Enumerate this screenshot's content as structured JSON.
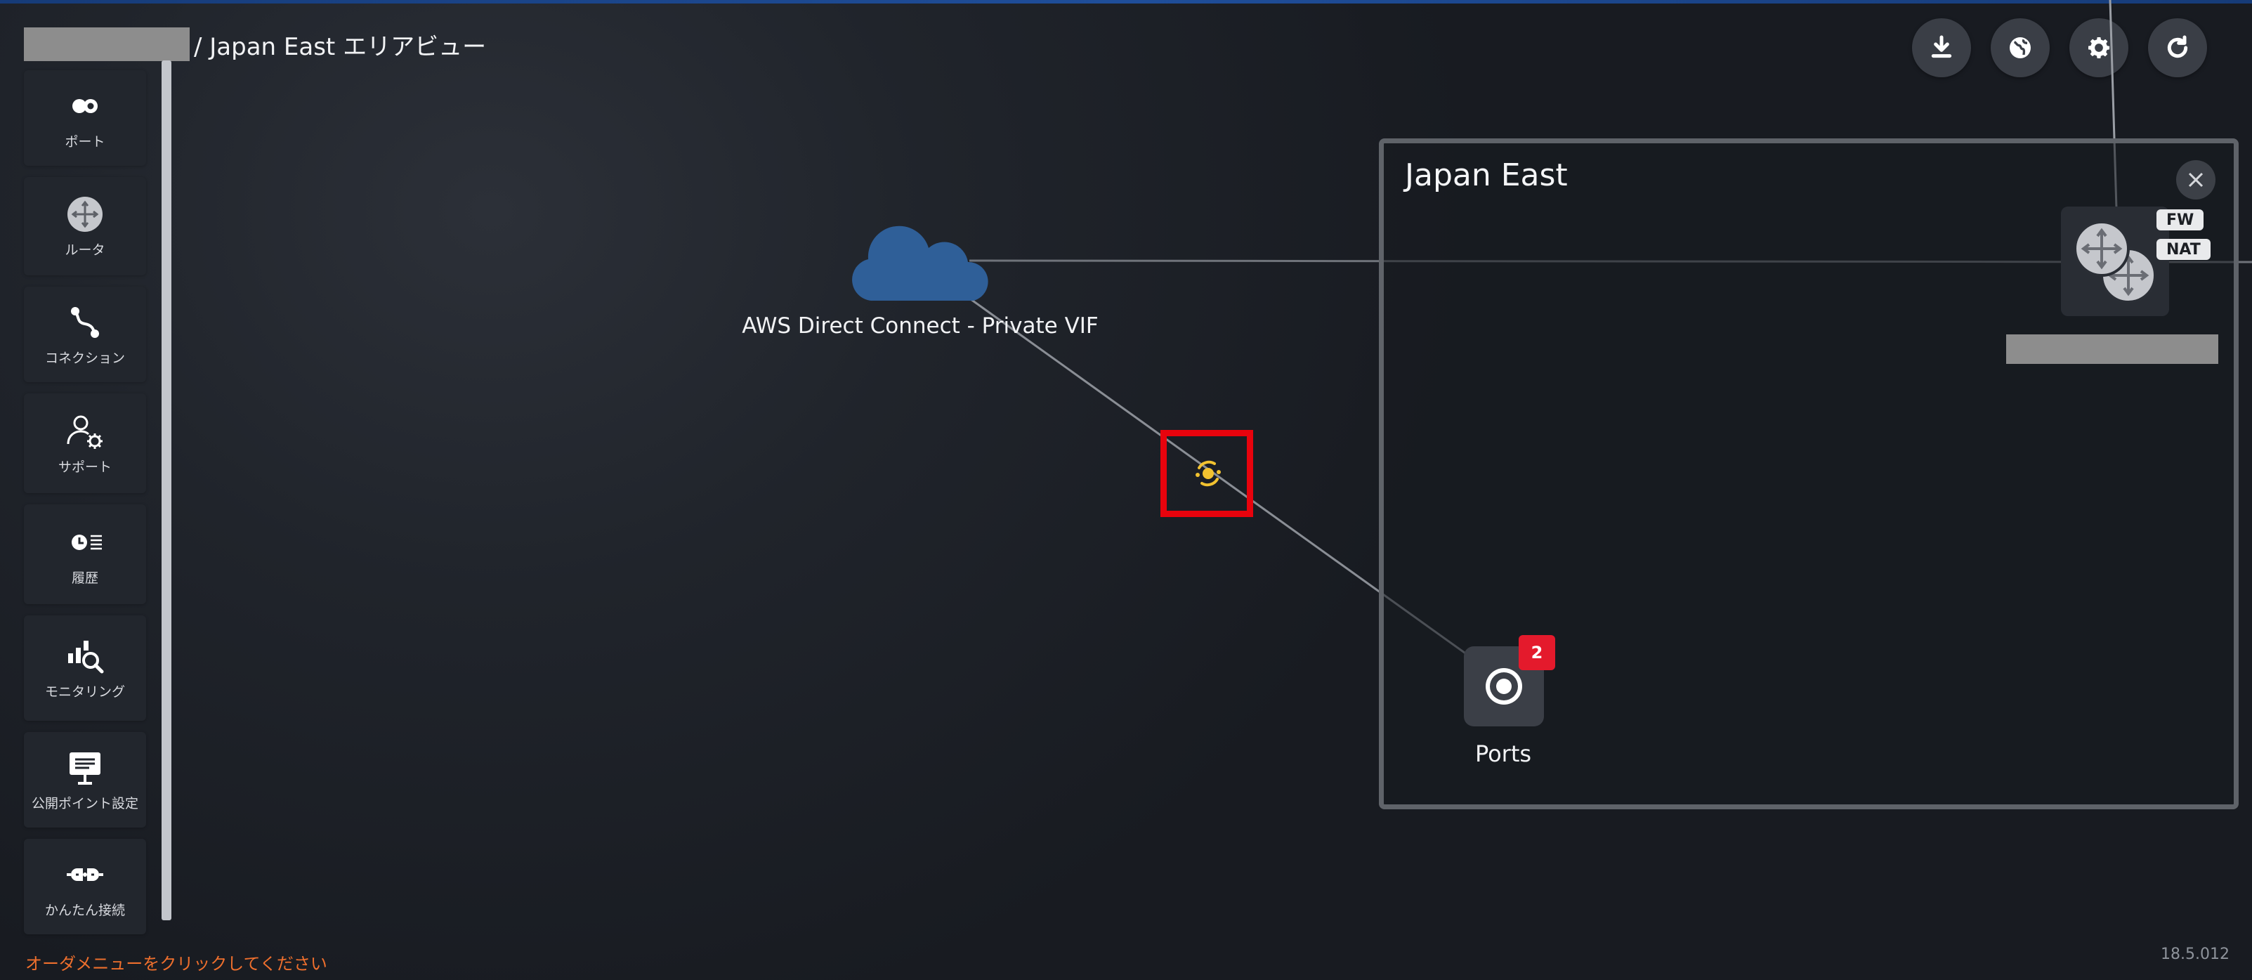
{
  "breadcrumb": {
    "area": "/ Japan East エリアビュー"
  },
  "top_actions": [
    {
      "icon": "download-icon"
    },
    {
      "icon": "globe-icon"
    },
    {
      "icon": "gear-icon"
    },
    {
      "icon": "refresh-icon"
    }
  ],
  "sidebar": {
    "items": [
      {
        "label": "ポート",
        "icon": "port-icon"
      },
      {
        "label": "ルータ",
        "icon": "router-icon"
      },
      {
        "label": "コネクション",
        "icon": "connection-icon"
      },
      {
        "label": "サポート",
        "icon": "support-icon"
      },
      {
        "label": "履歴",
        "icon": "history-icon"
      },
      {
        "label": "モニタリング",
        "icon": "monitoring-icon"
      },
      {
        "label": "公開ポイント設定",
        "icon": "public-point-icon"
      },
      {
        "label": "かんたん接続",
        "icon": "easy-connect-icon"
      }
    ]
  },
  "footer": {
    "hint": "オーダメニューをクリックしてください",
    "version": "18.5.012"
  },
  "canvas": {
    "cloud": {
      "label": "AWS Direct Connect - Private VIF",
      "color": "#2f5f98"
    },
    "area": {
      "title": "Japan East"
    },
    "router": {
      "tags": [
        "FW",
        "NAT"
      ]
    },
    "ports": {
      "label": "Ports",
      "badge": "2"
    }
  },
  "colors": {
    "accent_orange": "#ee6f2d",
    "highlight_red": "#e8030d",
    "vif_yellow": "#f2c230",
    "badge_red": "#e41a2c"
  }
}
